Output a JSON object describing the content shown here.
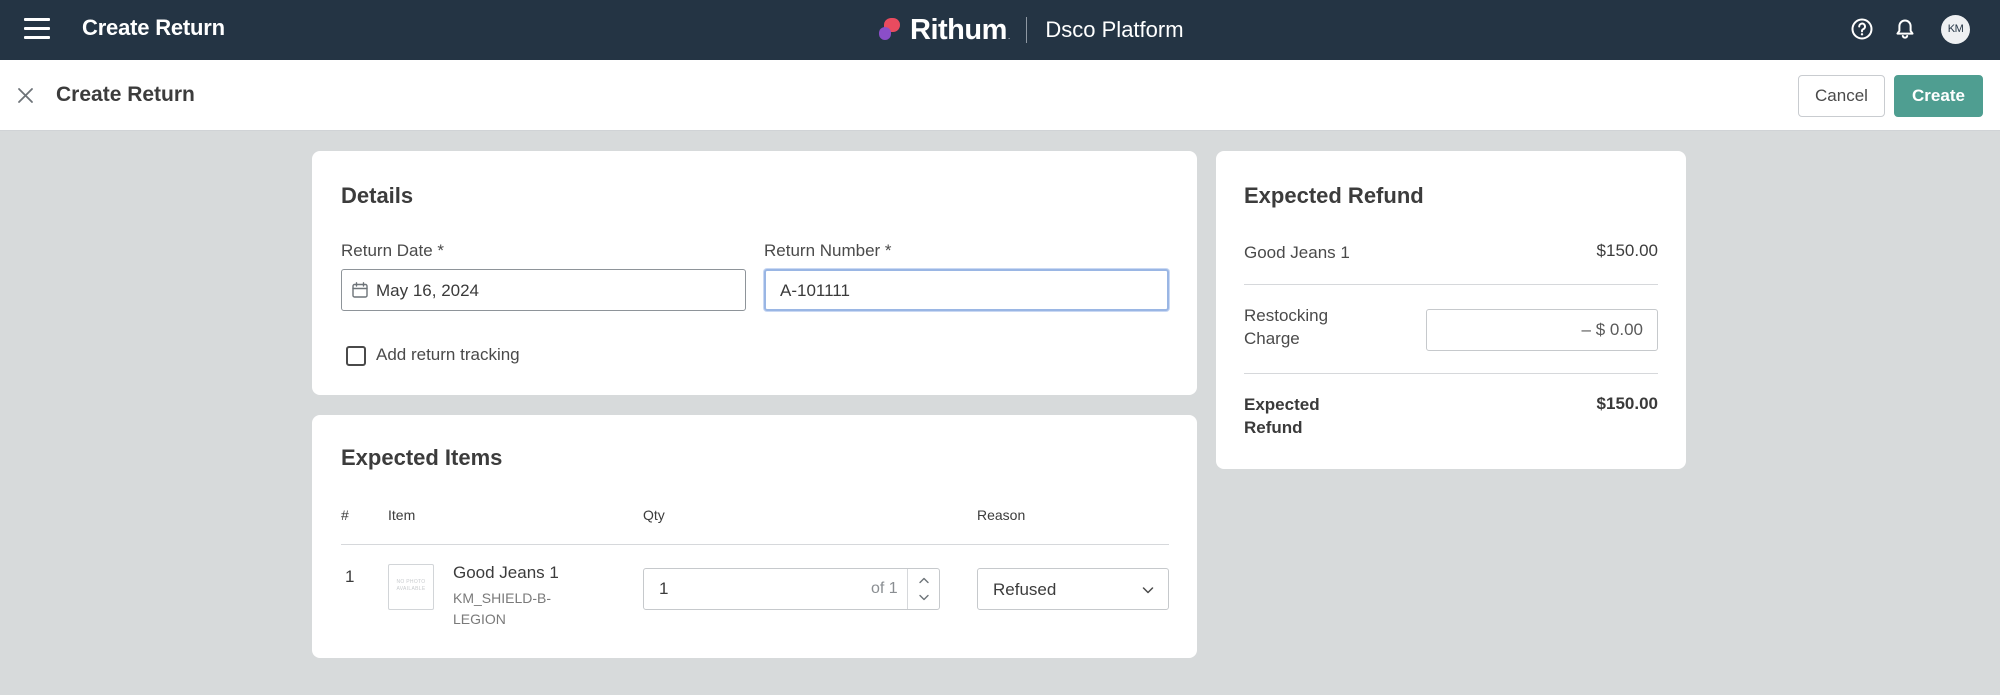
{
  "topbar": {
    "title": "Create Return",
    "brand_name": "Rithum",
    "brand_tm": ".",
    "brand_sub": "Dsco Platform",
    "help_icon": "help-circle-icon",
    "notifications_icon": "bell-icon",
    "avatar_initials": "KM"
  },
  "subheader": {
    "title": "Create Return",
    "cancel_label": "Cancel",
    "create_label": "Create"
  },
  "details": {
    "title": "Details",
    "return_date_label": "Return Date *",
    "return_date_value": "May 16, 2024",
    "return_number_label": "Return Number *",
    "return_number_value": "A-101111",
    "tracking_checkbox_label": "Add return tracking",
    "tracking_checked": false
  },
  "expected_items": {
    "title": "Expected Items",
    "columns": [
      "#",
      "Item",
      "Qty",
      "Reason"
    ],
    "rows": [
      {
        "index": "1",
        "thumb_text": "NO PHOTO AVAILABLE",
        "name": "Good Jeans 1",
        "sku": "KM_SHIELD-B-LEGION",
        "qty": "1",
        "qty_of": "of 1",
        "reason": "Refused"
      }
    ]
  },
  "refund": {
    "title": "Expected Refund",
    "item_label": "Good Jeans 1",
    "item_value": "$150.00",
    "restocking_label": "Restocking Charge",
    "restocking_value": "– $ 0.00",
    "total_label": "Expected Refund",
    "total_value": "$150.00"
  },
  "colors": {
    "topbar_bg": "#243444",
    "accent": "#4f9e91",
    "page_bg": "#d7dadb",
    "focus_ring": "#9ab6e4"
  }
}
